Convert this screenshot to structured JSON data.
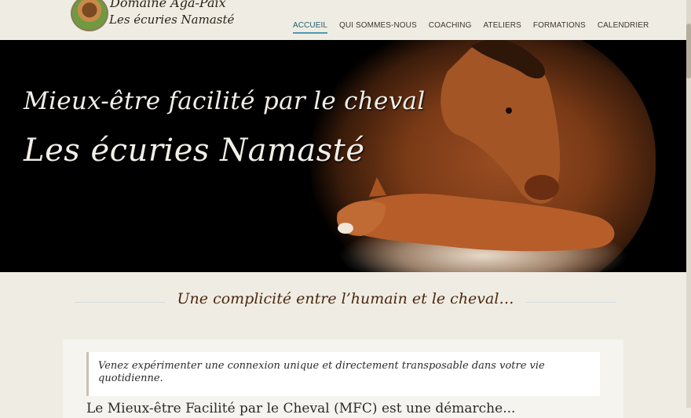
{
  "site": {
    "brand_line1": "Domaine Aga-Paix",
    "brand_line2": "Les écuries Namasté"
  },
  "nav": {
    "items": [
      {
        "label": "ACCUEIL",
        "active": true
      },
      {
        "label": "QUI SOMMES-NOUS",
        "active": false
      },
      {
        "label": "COACHING",
        "active": false
      },
      {
        "label": "ATELIERS",
        "active": false
      },
      {
        "label": "FORMATIONS",
        "active": false
      },
      {
        "label": "CALENDRIER",
        "active": false
      }
    ]
  },
  "hero": {
    "line1": "Mieux-être facilité par le cheval",
    "line2": "Les écuries Namasté"
  },
  "tagline": "Une complicité entre l’humain et le cheval…",
  "intro": {
    "quote": "Venez expérimenter une connexion unique et directement transposable dans votre vie quotidienne.",
    "next_text": "Le Mieux-être Facilité par le Cheval (MFC) est une démarche..."
  },
  "colors": {
    "accent": "#4a9bb2",
    "background": "#efece3",
    "tagline": "#4a2810"
  }
}
